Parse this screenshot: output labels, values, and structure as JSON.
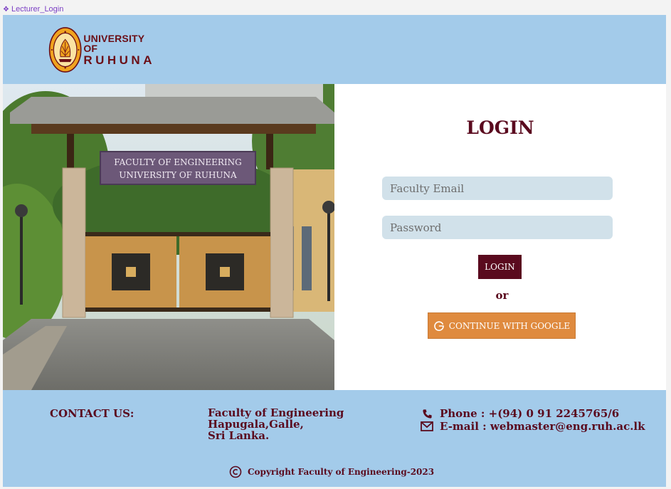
{
  "frame": {
    "label": "Lecturer_Login"
  },
  "header": {
    "logo_line1": "UNIVERSITY OF",
    "logo_line2": "RUHUNA"
  },
  "photo": {
    "sign_line1": "FACULTY OF ENGINEERING",
    "sign_line2": "UNIVERSITY OF RUHUNA"
  },
  "login": {
    "title": "LOGIN",
    "email_placeholder": "Faculty Email",
    "password_placeholder": "Password",
    "button_label": "LOGIN",
    "or_text": "or",
    "google_label": "CONTINUE WITH GOOGLE",
    "google_icon": "google-g-icon"
  },
  "footer": {
    "contact_label": "CONTACT US:",
    "address_line1": "Faculty of Engineering",
    "address_line2": "Hapugala,Galle,",
    "address_line3": "Sri Lanka.",
    "phone": "Phone : +(94) 0 91 2245765/6",
    "email": "E-mail : webmaster@eng.ruh.ac.lk",
    "copyright": "Copyright Faculty of Engineering-2023"
  },
  "colors": {
    "header_bg": "#a3cbea",
    "primary": "#5a0a1e",
    "google_button": "#df8a3e",
    "input_bg": "#d1e1ea"
  }
}
